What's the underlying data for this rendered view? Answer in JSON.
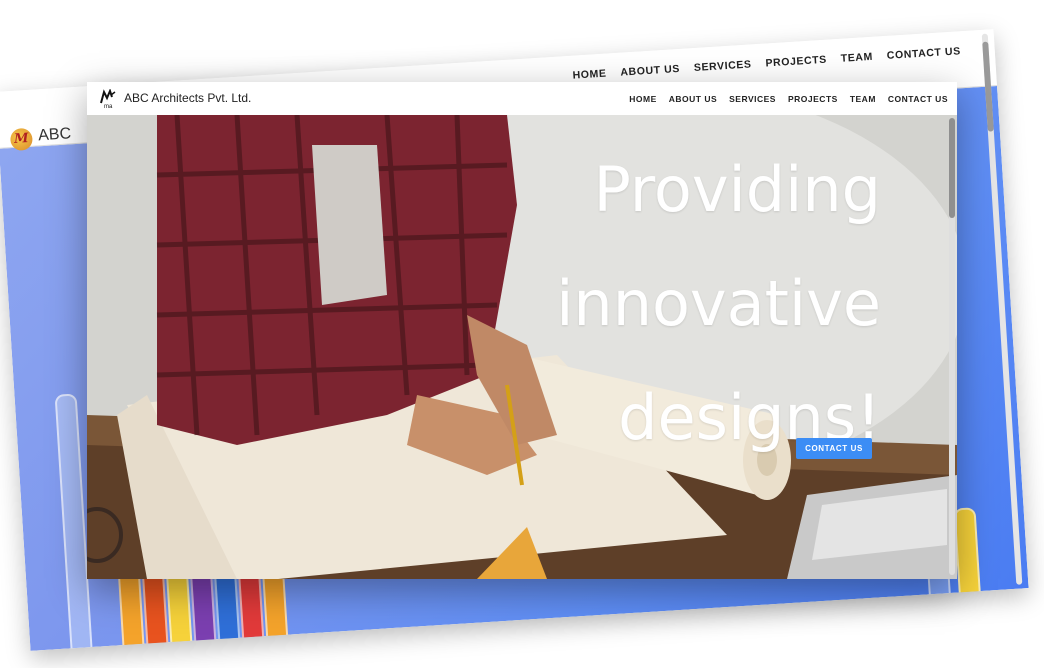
{
  "back_window": {
    "brand": "ABC",
    "nav": [
      "HOME",
      "ABOUT US",
      "SERVICES",
      "PROJECTS",
      "TEAM",
      "CONTACT US"
    ]
  },
  "front_window": {
    "brand": "ABC Architects Pvt. Ltd.",
    "logo_text": "ma",
    "nav": {
      "home": "HOME",
      "about": "ABOUT US",
      "services": "SERVICES",
      "projects": "PROJECTS",
      "team": "TEAM",
      "contact": "CONTACT US"
    },
    "hero": {
      "line1": "Providing",
      "line2": "innovative",
      "line3": "designs!",
      "button": "CONTACT US"
    }
  },
  "colors": {
    "accent": "#3c8df5",
    "back_hero": "#6a90f2"
  }
}
